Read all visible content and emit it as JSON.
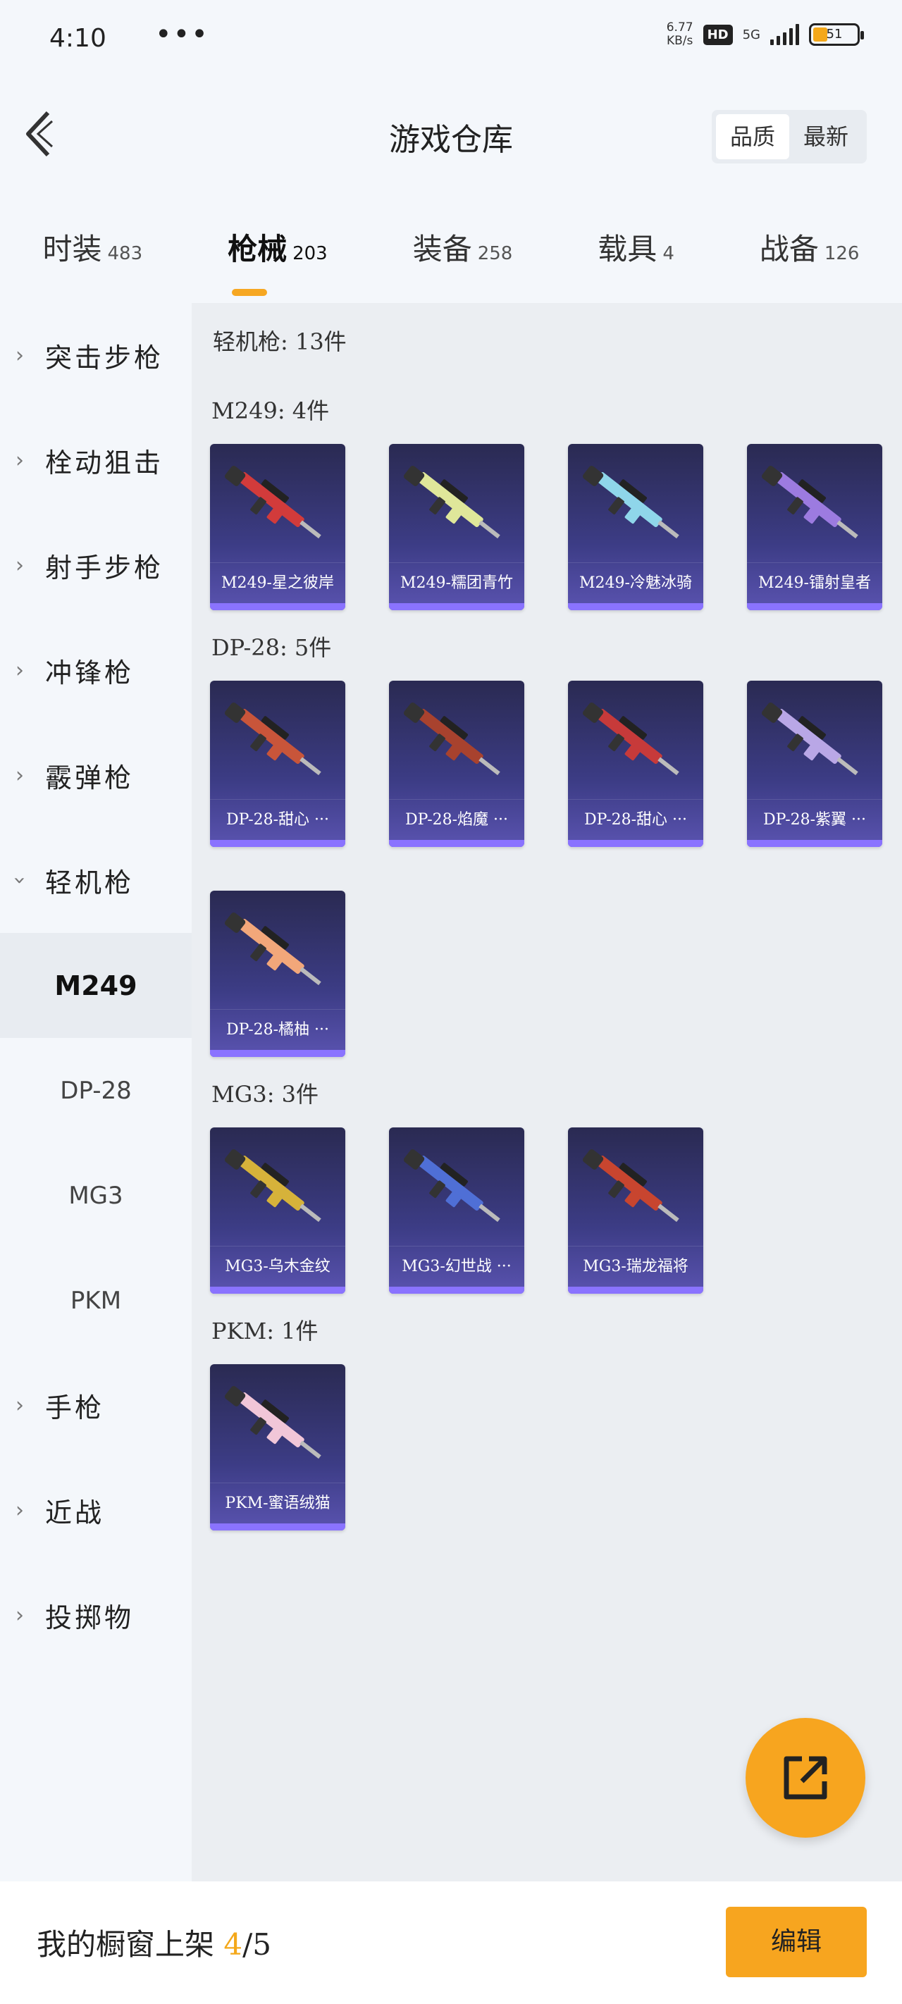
{
  "status_bar": {
    "time": "4:10",
    "dots": "•••",
    "net_speed_value": "6.77",
    "net_speed_unit": "KB/s",
    "hd": "HD",
    "network": "5G",
    "battery": "51"
  },
  "header": {
    "title": "游戏仓库",
    "sort_options": [
      "品质",
      "最新"
    ],
    "sort_selected": "品质"
  },
  "tabs": [
    {
      "label": "时装",
      "count": "483"
    },
    {
      "label": "枪械",
      "count": "203"
    },
    {
      "label": "装备",
      "count": "258"
    },
    {
      "label": "载具",
      "count": "4"
    },
    {
      "label": "战备",
      "count": "126"
    }
  ],
  "active_tab": "枪械",
  "sidebar": {
    "categories": [
      "突击步枪",
      "栓动狙击",
      "射手步枪",
      "冲锋枪",
      "霰弹枪",
      "轻机枪",
      "手枪",
      "近战",
      "投掷物"
    ],
    "expanded": "轻机枪",
    "sub_items": [
      "M249",
      "DP-28",
      "MG3",
      "PKM"
    ],
    "active_sub": "M249"
  },
  "content": {
    "category_title": "轻机枪: 13件",
    "groups": [
      {
        "title": "M249: 4件",
        "items": [
          {
            "name": "M249-星之彼岸",
            "accent": "#d23b3b"
          },
          {
            "name": "M249-糯团青竹",
            "accent": "#dfe79a"
          },
          {
            "name": "M249-冷魅冰骑",
            "accent": "#8fd6ea"
          },
          {
            "name": "M249-镭射皇者",
            "accent": "#9c7be0"
          }
        ]
      },
      {
        "title": "DP-28: 5件",
        "items": [
          {
            "name": "DP-28-甜心 ···",
            "accent": "#c8553a"
          },
          {
            "name": "DP-28-焰魔 ···",
            "accent": "#a8422e"
          },
          {
            "name": "DP-28-甜心 ···",
            "accent": "#c73a3a"
          },
          {
            "name": "DP-28-紫翼 ···",
            "accent": "#b9a7e6"
          },
          {
            "name": "DP-28-橘柚 ···",
            "accent": "#f2a77a"
          }
        ]
      },
      {
        "title": "MG3: 3件",
        "items": [
          {
            "name": "MG3-乌木金纹",
            "accent": "#d6b23a"
          },
          {
            "name": "MG3-幻世战 ···",
            "accent": "#4f6fd6"
          },
          {
            "name": "MG3-瑞龙福将",
            "accent": "#c8452f"
          }
        ]
      },
      {
        "title": "PKM: 1件",
        "items": [
          {
            "name": "PKM-蜜语绒猫",
            "accent": "#f1c6d8"
          }
        ]
      }
    ]
  },
  "footer": {
    "label": "我的橱窗上架",
    "count": "4",
    "total": "/5",
    "edit_label": "编辑"
  },
  "colors": {
    "accent": "#f7a51f",
    "card_bottom_bar": "#8a73ff"
  }
}
